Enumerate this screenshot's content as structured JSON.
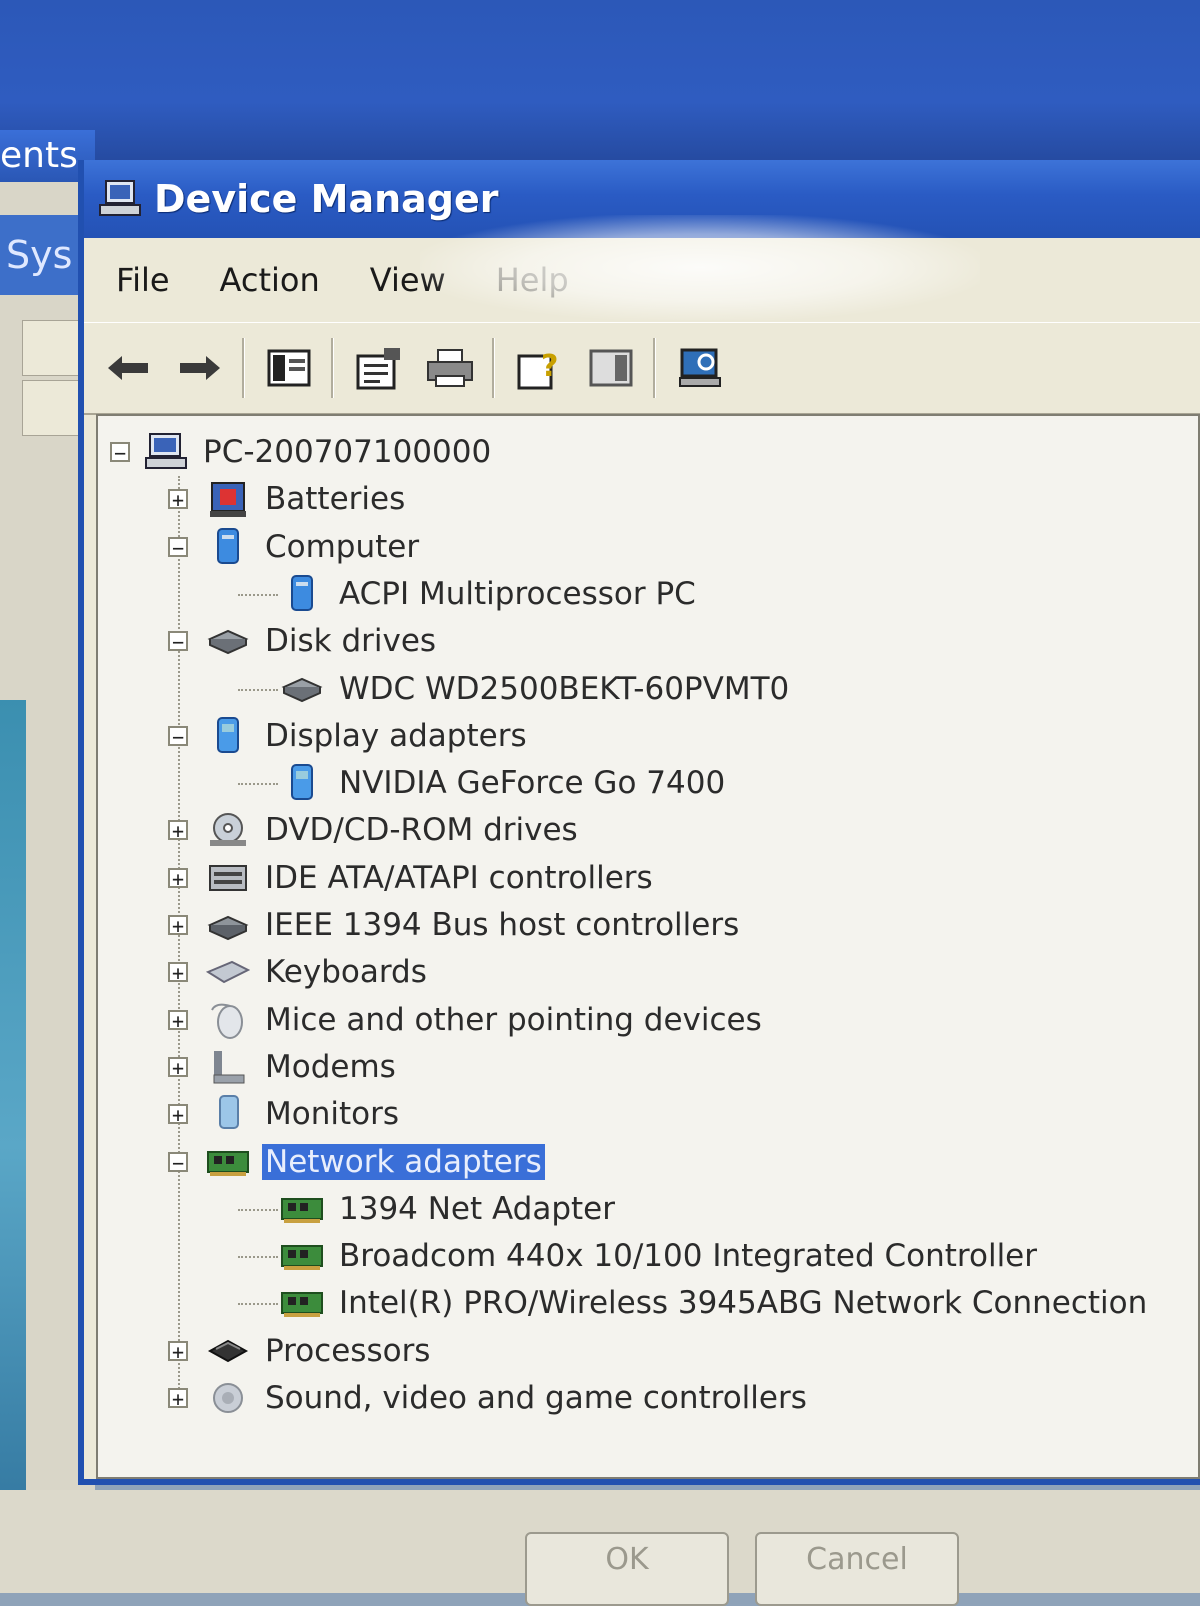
{
  "background": {
    "bg_window_title": "ents",
    "bg_window_side": "Sys",
    "ok_button": "OK",
    "cancel_button": "Cancel"
  },
  "window": {
    "title": "Device Manager",
    "menu": [
      "File",
      "Action",
      "View",
      "Help"
    ],
    "toolbar_icons": [
      "back-arrow-icon",
      "forward-arrow-icon",
      "show-hide-console-tree-icon",
      "properties-icon",
      "print-icon",
      "help-icon",
      "show-hide-action-pane-icon",
      "scan-hardware-icon"
    ]
  },
  "tree": {
    "root": "PC-200707100000",
    "nodes": [
      {
        "label": "Batteries",
        "expander": "+",
        "icon": "battery-icon"
      },
      {
        "label": "Computer",
        "expander": "−",
        "icon": "computer-icon"
      },
      {
        "label": "ACPI Multiprocessor PC",
        "child": true,
        "icon": "computer-icon"
      },
      {
        "label": "Disk drives",
        "expander": "−",
        "icon": "disk-drive-icon"
      },
      {
        "label": "WDC WD2500BEKT-60PVMT0",
        "child": true,
        "icon": "disk-drive-icon"
      },
      {
        "label": "Display adapters",
        "expander": "−",
        "icon": "display-adapter-icon"
      },
      {
        "label": "NVIDIA GeForce Go 7400",
        "child": true,
        "icon": "display-adapter-icon"
      },
      {
        "label": "DVD/CD-ROM drives",
        "expander": "+",
        "icon": "cdrom-icon"
      },
      {
        "label": "IDE ATA/ATAPI controllers",
        "expander": "+",
        "icon": "ide-controller-icon"
      },
      {
        "label": "IEEE 1394 Bus host controllers",
        "expander": "+",
        "icon": "firewire-icon"
      },
      {
        "label": "Keyboards",
        "expander": "+",
        "icon": "keyboard-icon"
      },
      {
        "label": "Mice and other pointing devices",
        "expander": "+",
        "icon": "mouse-icon"
      },
      {
        "label": "Modems",
        "expander": "+",
        "icon": "modem-icon"
      },
      {
        "label": "Monitors",
        "expander": "+",
        "icon": "monitor-icon"
      },
      {
        "label": "Network adapters",
        "expander": "−",
        "icon": "network-adapter-icon",
        "selected": true
      },
      {
        "label": "1394 Net Adapter",
        "child": true,
        "icon": "network-adapter-icon"
      },
      {
        "label": "Broadcom 440x 10/100 Integrated Controller",
        "child": true,
        "icon": "network-adapter-icon"
      },
      {
        "label": "Intel(R) PRO/Wireless 3945ABG Network Connection",
        "child": true,
        "icon": "network-adapter-icon"
      },
      {
        "label": "Processors",
        "expander": "+",
        "icon": "processor-icon"
      },
      {
        "label": "Sound, video and game controllers",
        "expander": "+",
        "icon": "sound-icon"
      }
    ]
  },
  "colors": {
    "titlebar": "#2a5bc4",
    "selection": "#3a6fd8",
    "window_face": "#ece9d8"
  }
}
